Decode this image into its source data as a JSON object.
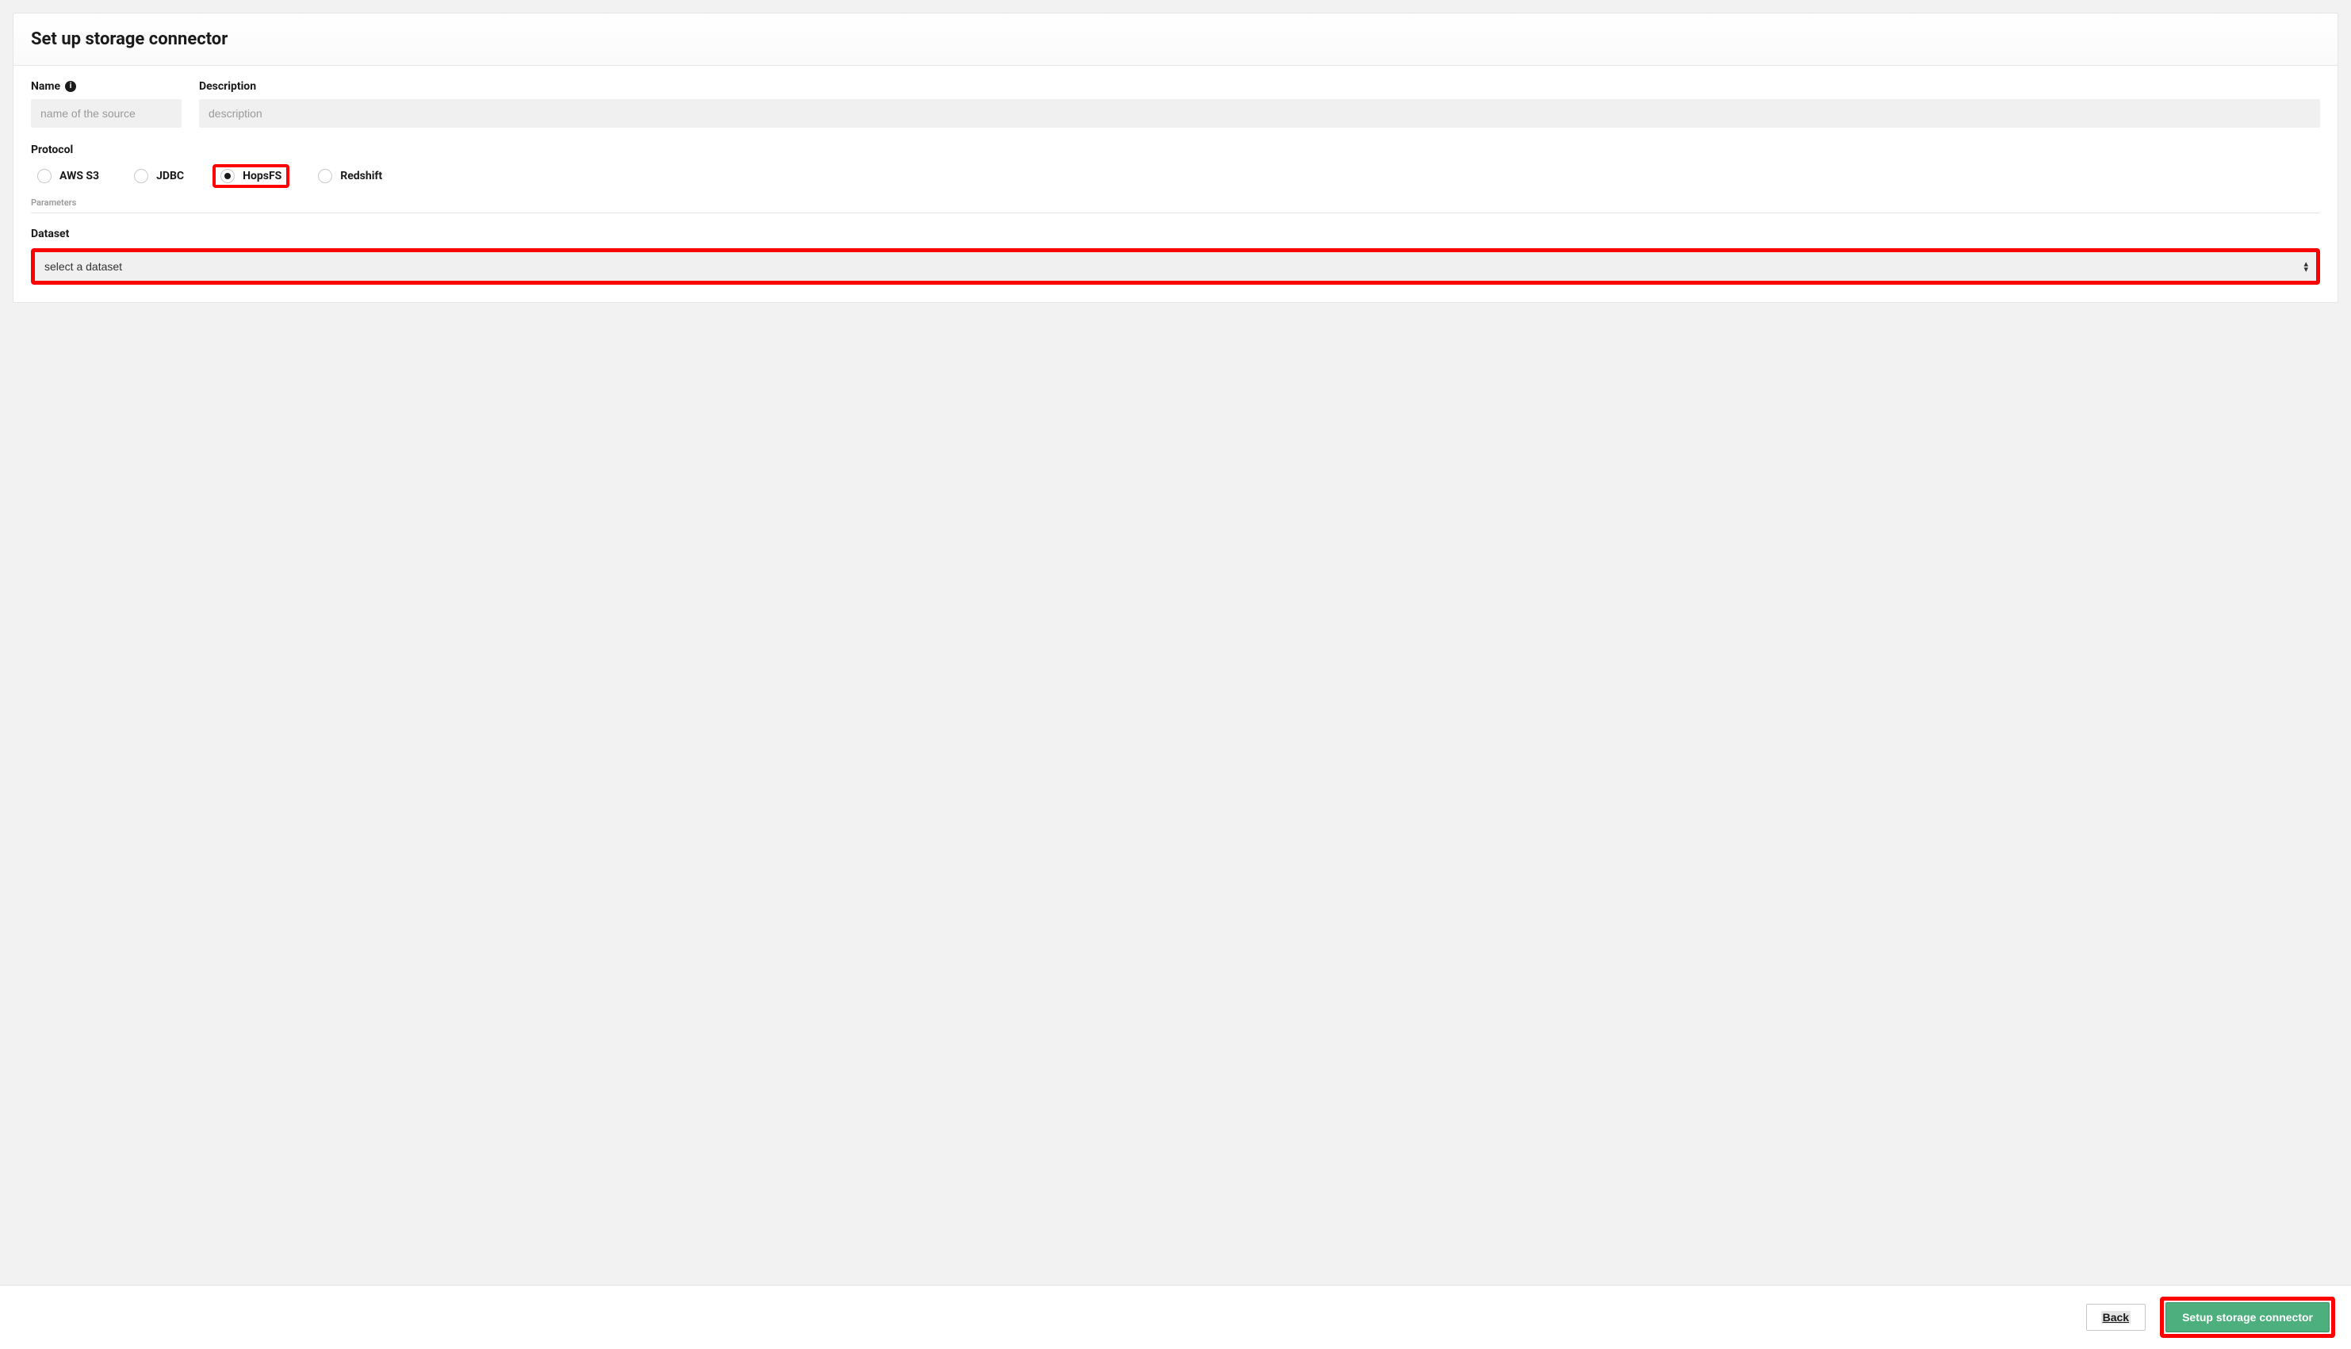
{
  "header": {
    "title": "Set up storage connector"
  },
  "fields": {
    "name": {
      "label": "Name",
      "placeholder": "name of the source",
      "value": ""
    },
    "description": {
      "label": "Description",
      "placeholder": "description",
      "value": ""
    }
  },
  "protocol": {
    "label": "Protocol",
    "selected": "HopsFS",
    "options": [
      "AWS S3",
      "JDBC",
      "HopsFS",
      "Redshift"
    ]
  },
  "parameters": {
    "label": "Parameters"
  },
  "dataset": {
    "label": "Dataset",
    "placeholder": "select a dataset",
    "value": ""
  },
  "footer": {
    "back_label": "Back",
    "submit_label": "Setup storage connector"
  },
  "highlights": {
    "protocol_option": "HopsFS",
    "dataset_select": true,
    "submit_button": true
  }
}
